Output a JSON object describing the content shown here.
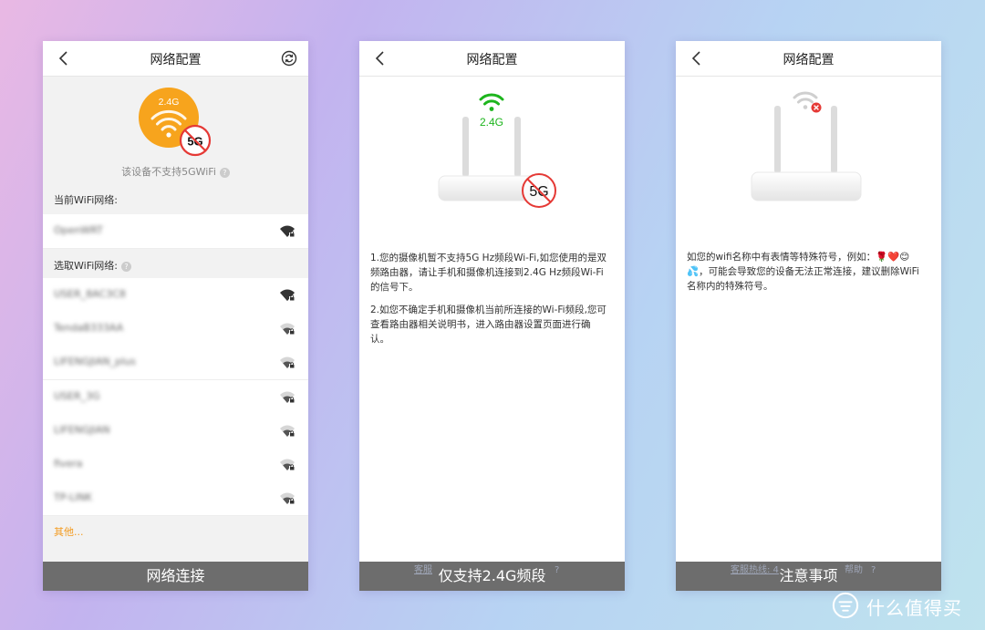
{
  "panel1": {
    "title": "网络配置",
    "badge_band": "2.4G",
    "badge_forbidden": "5G",
    "note": "该设备不支持5GWiFi",
    "current_label": "当前WiFi网络:",
    "current_network": "OpenWRT",
    "select_label": "选取WiFi网络:",
    "networks": [
      "USER_8AC3C8",
      "TendaB333AA",
      "LIFENGJIAN_plus",
      "USER_3G",
      "LIFENGJIAN",
      "fivera",
      "TP-LINK"
    ],
    "other_link": "其他...",
    "caption": "网络连接"
  },
  "panel2": {
    "title": "网络配置",
    "band_label": "2.4G",
    "forbidden_label": "5G",
    "paragraph1": "1.您的摄像机暂不支持5G Hz频段Wi-Fi,如您使用的是双频路由器，请让手机和摄像机连接到2.4G Hz频段Wi-Fi的信号下。",
    "paragraph2": "2.如您不确定手机和摄像机当前所连接的Wi-Fi频段,您可查看路由器相关说明书，进入路由器设置页面进行确认。",
    "under_text": "客服",
    "caption": "仅支持2.4G频段"
  },
  "panel3": {
    "title": "网络配置",
    "paragraph": "如您的wifi名称中有表情等特殊符号，例如：🌹❤️😊💦，可能会导致您的设备无法正常连接，建议删除WiFi名称内的特殊符号。",
    "under_hotline": "客服热线: 4",
    "under_help": "帮助",
    "caption": "注意事项"
  },
  "watermark": "什么值得买",
  "colors": {
    "orange": "#f7a41d",
    "green": "#1db51d",
    "red": "#e53935",
    "link_orange": "#f39a1e",
    "bar_gray": "#6d6d6d"
  }
}
